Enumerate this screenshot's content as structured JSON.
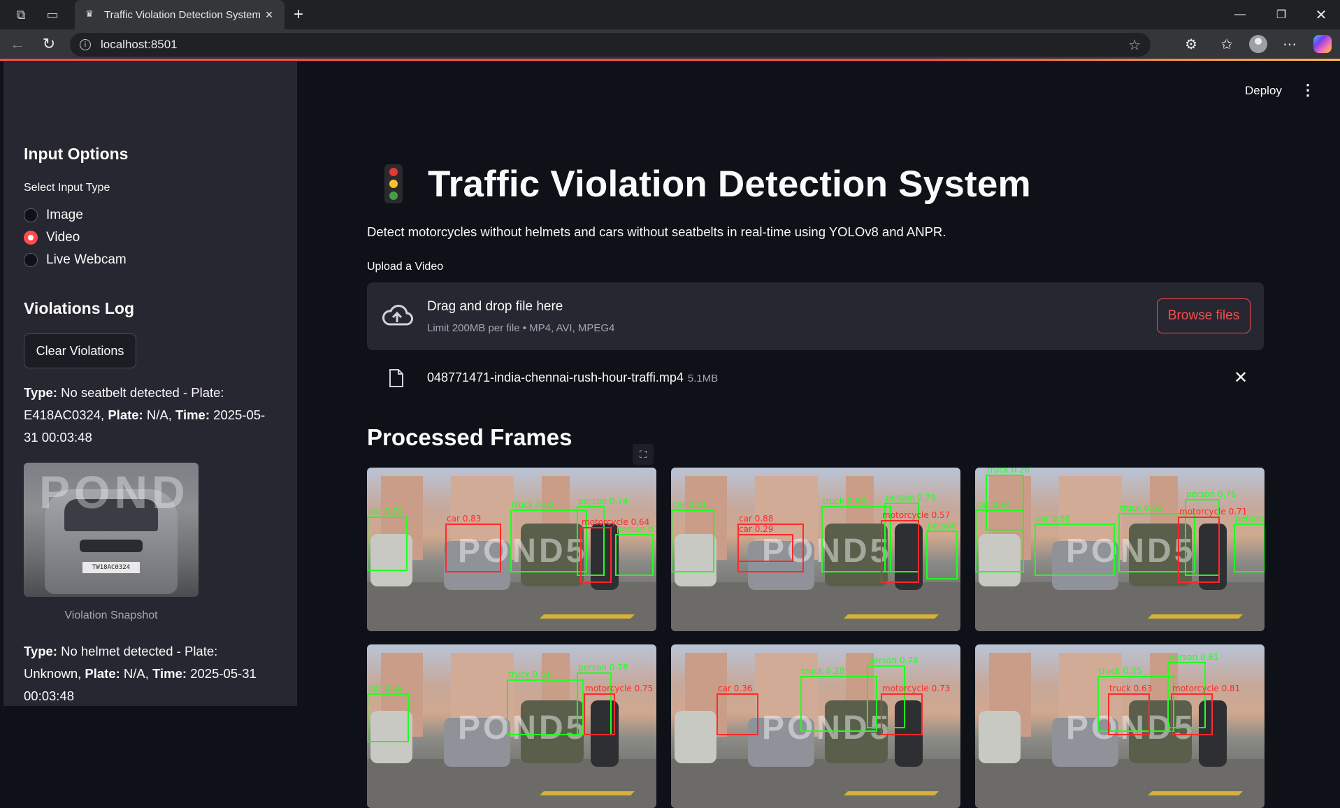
{
  "browser": {
    "tab_title": "Traffic Violation Detection System",
    "url": "localhost:8501"
  },
  "toolbar": {
    "deploy_label": "Deploy",
    "menu_icon": "⋮"
  },
  "sidebar": {
    "input_heading": "Input Options",
    "select_label": "Select Input Type",
    "options": [
      "Image",
      "Video",
      "Live Webcam"
    ],
    "selected": "Video",
    "log_heading": "Violations Log",
    "clear_button": "Clear Violations",
    "violations": [
      {
        "type_label": "Type:",
        "type_value": " No seatbelt detected - Plate: E418AC0324,",
        "plate_label": "Plate:",
        "plate_value": " N/A,",
        "time_label": "Time:",
        "time_value": " 2025-05-31 00:03:48",
        "snapshot_caption": "Violation Snapshot",
        "snapshot_plate": "TW18AC0324",
        "snapshot_watermark": "POND"
      },
      {
        "type_label": "Type:",
        "type_value": " No helmet detected - Plate: Unknown,",
        "plate_label": "Plate:",
        "plate_value": " N/A,",
        "time_label": "Time:",
        "time_value": " 2025-05-31 00:03:48"
      }
    ]
  },
  "main": {
    "title": "Traffic Violation Detection System",
    "subtitle": "Detect motorcycles without helmets and cars without seatbelts in real-time using YOLOv8 and ANPR.",
    "upload_label": "Upload a Video",
    "dropzone": {
      "main_text": "Drag and drop file here",
      "limit_text": "Limit 200MB per file • MP4, AVI, MPEG4",
      "browse_label": "Browse files"
    },
    "file": {
      "name": "048771471-india-chennai-rush-hour-traffi.mp4",
      "size": "5.1MB"
    },
    "section_heading": "Processed Frames",
    "frame_watermark": "POND5",
    "frames": [
      {
        "labels": [
          "car 0.72",
          "car 0.83",
          "truck 0.62",
          "person 0.74",
          "motorcycle 0.64",
          "person 0.5"
        ]
      },
      {
        "labels": [
          "car 0.61",
          "car 0.88",
          "car 0.29",
          "truck 0.58",
          "person 0.79",
          "motorcycle 0.57",
          "person"
        ]
      },
      {
        "labels": [
          "truck 0.26",
          "car 0.64",
          "car 0.88",
          "truck 0.63",
          "person 0.76",
          "motorcycle 0.71",
          "person"
        ]
      },
      {
        "labels": [
          "car 0.69",
          "truck 0.51",
          "person 0.78",
          "motorcycle 0.75"
        ]
      },
      {
        "labels": [
          "truck 0.28",
          "car 0.36",
          "person 0.78",
          "motorcycle 0.73"
        ]
      },
      {
        "labels": [
          "truck 0.35",
          "truck 0.63",
          "person 0.81",
          "motorcycle 0.81"
        ]
      }
    ]
  }
}
